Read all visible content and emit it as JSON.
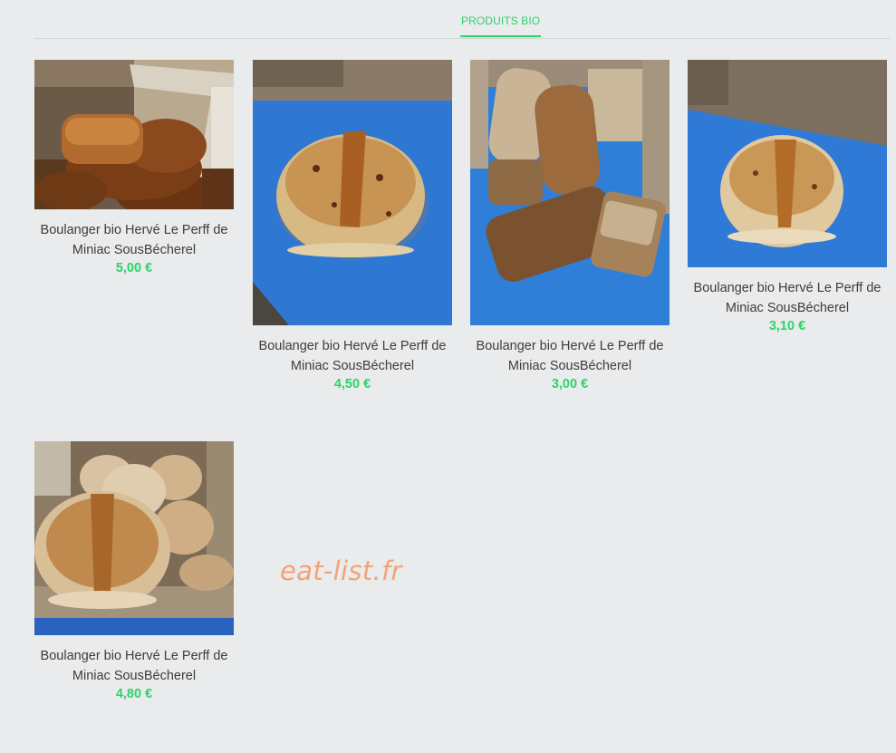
{
  "tabs": [
    {
      "label": "PRODUITS BIO",
      "active": true
    }
  ],
  "accent_color": "#2bd46b",
  "products": [
    {
      "name": "Boulanger bio Hervé Le Perff de Miniac SousBécherel",
      "price": "5,00 €",
      "photo": "bread-loaves-in-crate-photo"
    },
    {
      "name": "Boulanger bio Hervé Le Perff de Miniac SousBécherel",
      "price": "4,50 €",
      "photo": "round-fruit-bread-photo"
    },
    {
      "name": "Boulanger bio Hervé Le Perff de Miniac SousBécherel",
      "price": "3,00 €",
      "photo": "assorted-loaves-photo"
    },
    {
      "name": "Boulanger bio Hervé Le Perff de Miniac SousBécherel",
      "price": "3,10 €",
      "photo": "round-country-loaf-photo"
    },
    {
      "name": "Boulanger bio Hervé Le Perff de Miniac SousBécherel",
      "price": "4,80 €",
      "photo": "round-loaves-in-crate-photo"
    }
  ],
  "watermark": "eat-list.fr"
}
